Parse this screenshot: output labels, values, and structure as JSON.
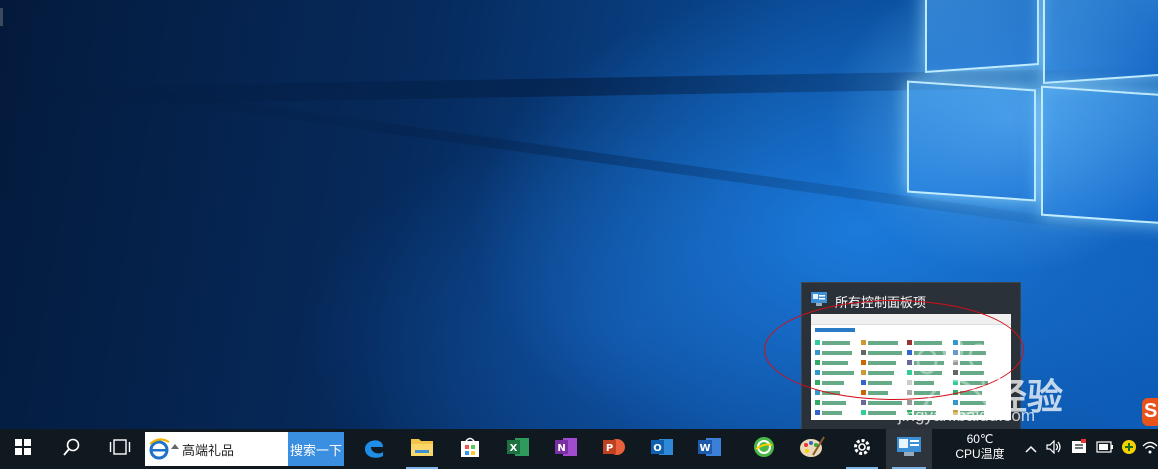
{
  "preview": {
    "title": "所有控制面板项"
  },
  "watermark": {
    "brand": "经验",
    "url": "jingyan.baidu.com"
  },
  "search": {
    "value": "高端礼品",
    "button_label": "搜索一下"
  },
  "taskbar": {
    "apps": [
      {
        "name": "start-icon"
      },
      {
        "name": "search-icon"
      },
      {
        "name": "task-view-icon"
      },
      {
        "name": "edge-icon"
      },
      {
        "name": "file-explorer-icon"
      },
      {
        "name": "store-icon"
      },
      {
        "name": "excel-icon"
      },
      {
        "name": "onenote-icon"
      },
      {
        "name": "powerpoint-icon"
      },
      {
        "name": "outlook-icon"
      },
      {
        "name": "word-icon"
      },
      {
        "name": "360-browser-icon"
      },
      {
        "name": "paint-icon"
      },
      {
        "name": "settings-icon"
      },
      {
        "name": "control-panel-icon"
      }
    ]
  },
  "tray": {
    "cpu_temp_value": "60℃",
    "cpu_temp_label": "CPU温度"
  },
  "colors": {
    "taskbar": "#101820",
    "search_button": "#3b8fe0",
    "annotation": "#d0101a"
  }
}
